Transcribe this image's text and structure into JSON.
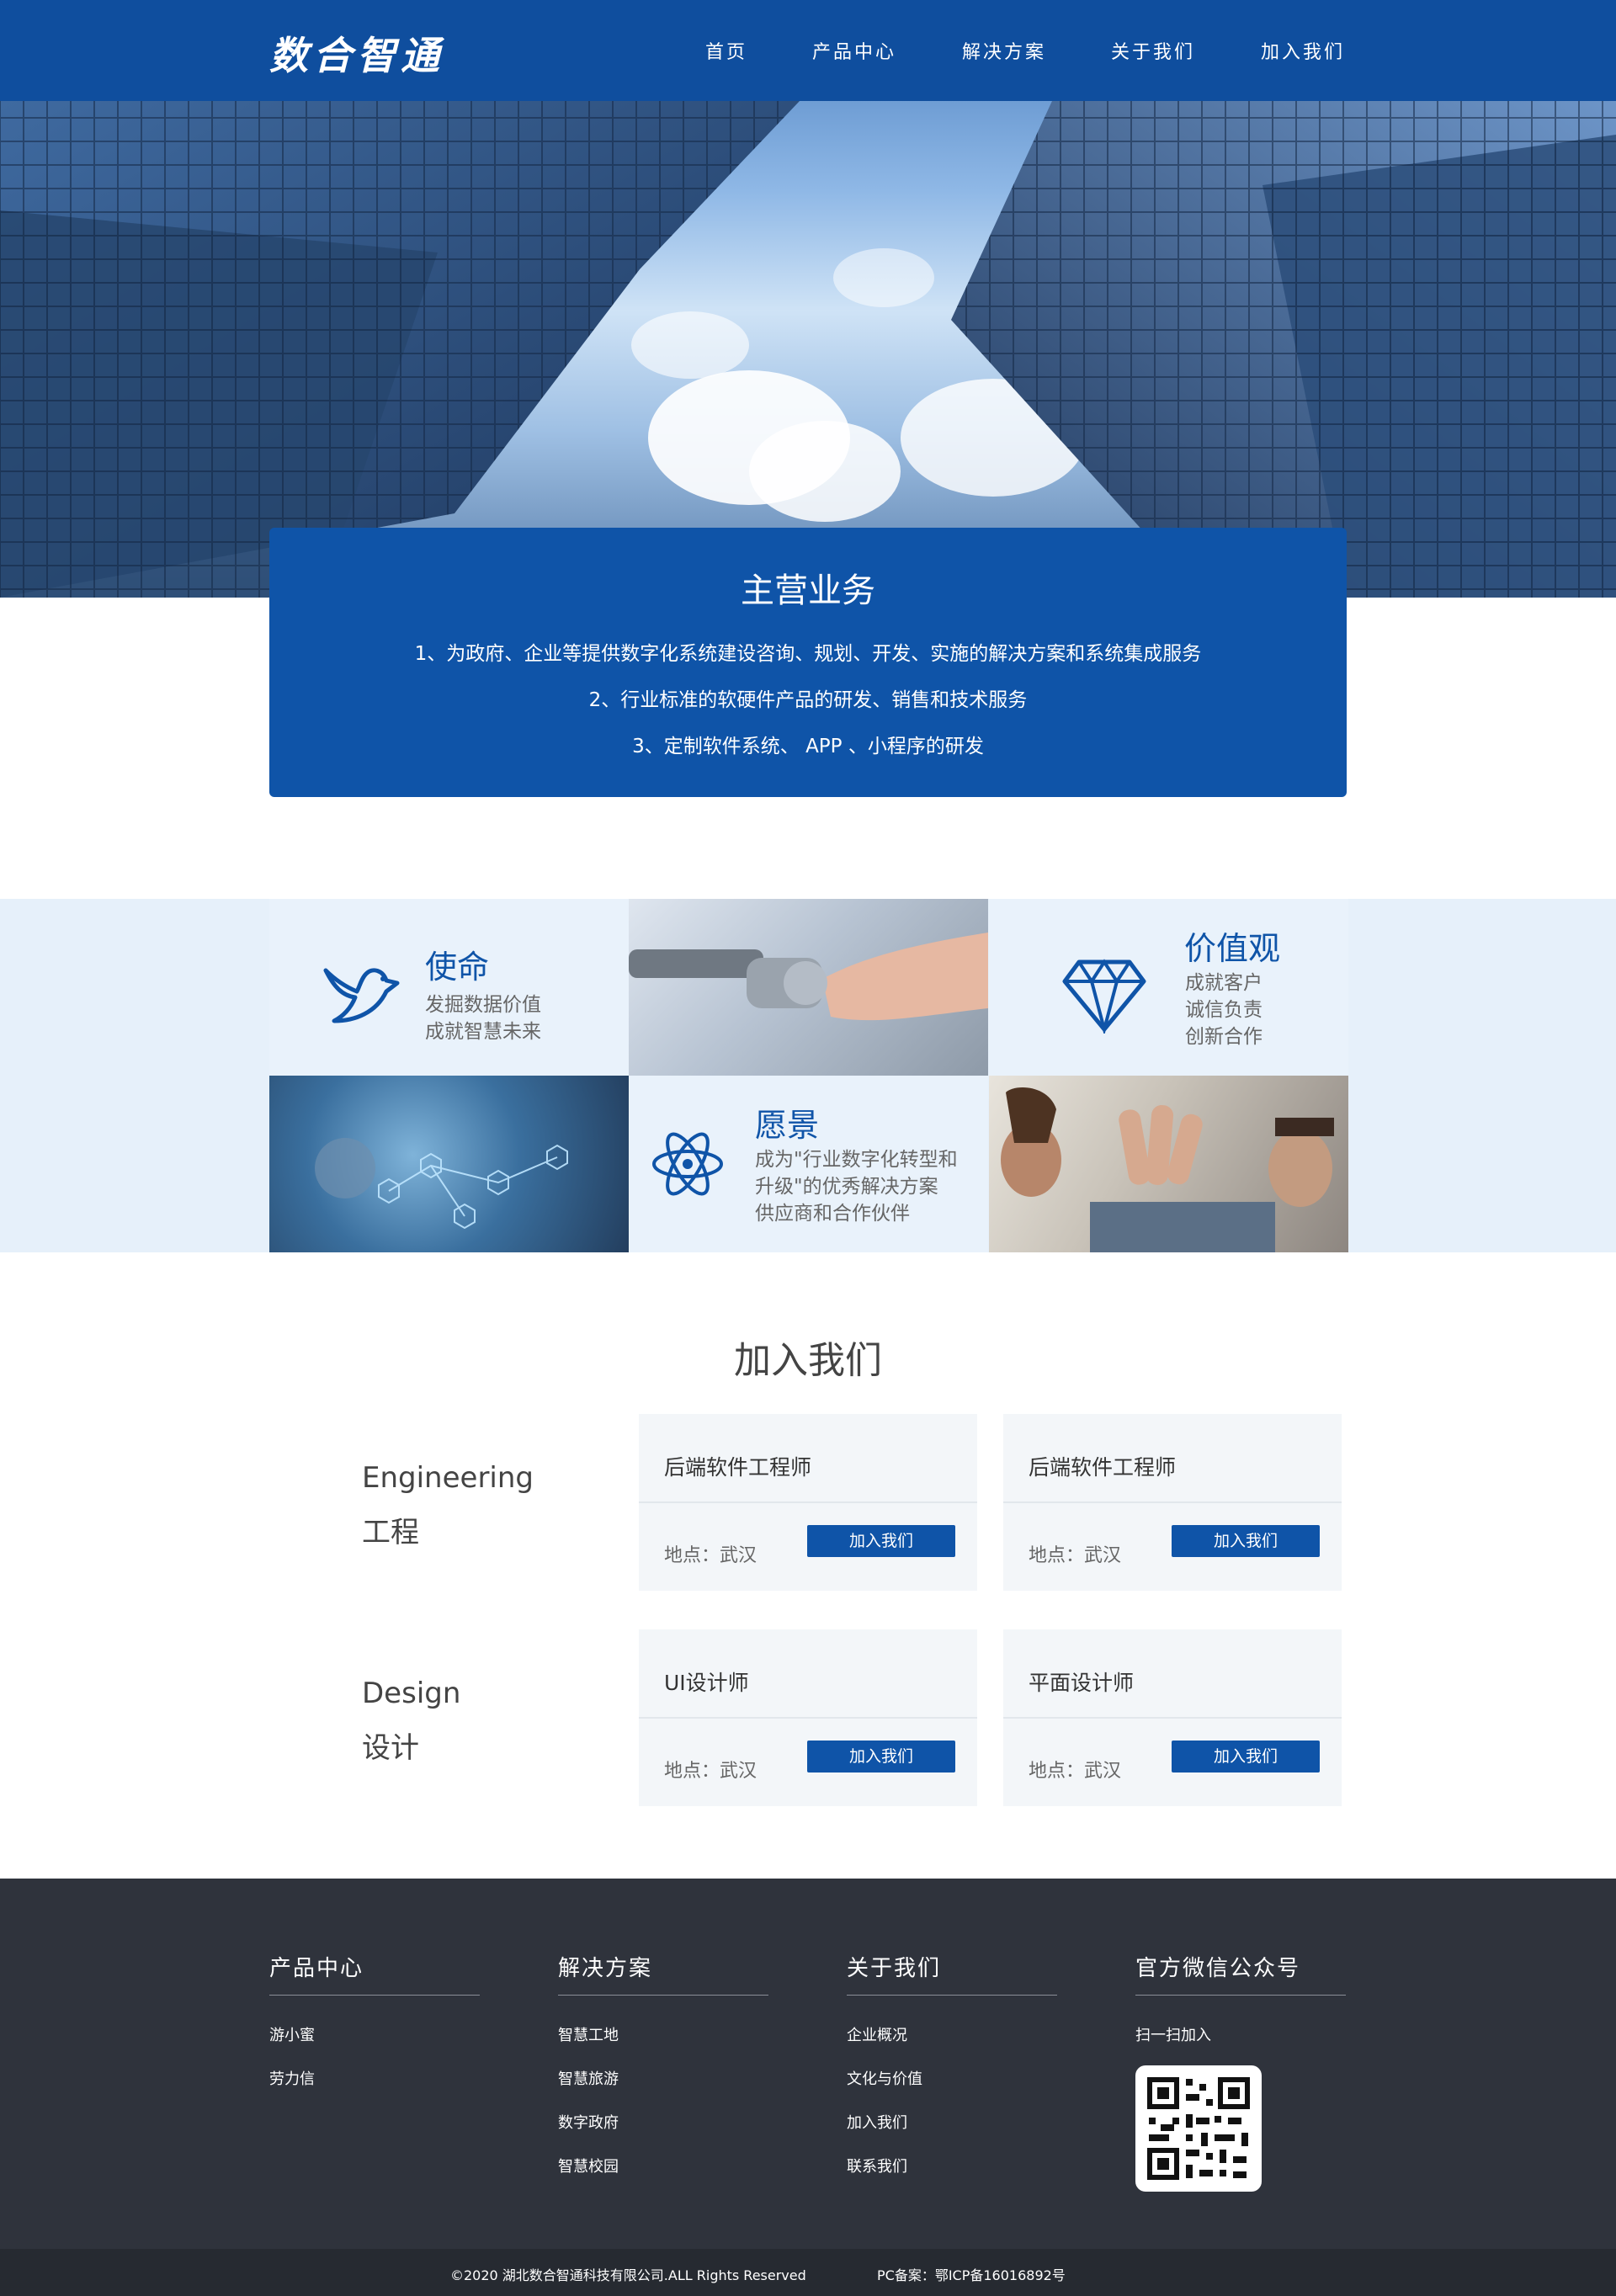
{
  "brand": {
    "logo": "数合智通"
  },
  "nav": {
    "items": [
      "首页",
      "产品中心",
      "解决方案",
      "关于我们",
      "加入我们"
    ]
  },
  "business": {
    "title": "主营业务",
    "lines": [
      "1、为政府、企业等提供数字化系统建设咨询、规划、开发、实施的解决方案和系统集成服务",
      "2、行业标准的软硬件产品的研发、销售和技术服务",
      "3、定制软件系统、 APP 、小程序的研发"
    ]
  },
  "values": {
    "mission": {
      "title": "使命",
      "lines": [
        "发掘数据价值",
        "成就智慧未来"
      ],
      "icon": "dove-icon"
    },
    "value": {
      "title": "价值观",
      "lines": [
        "成就客户",
        "诚信负责",
        "创新合作"
      ],
      "icon": "diamond-icon"
    },
    "vision": {
      "title": "愿景",
      "lines": [
        "成为\"行业数字化转型和",
        "升级\"的优秀解决方案",
        "供应商和合作伙伴"
      ],
      "icon": "atom-icon"
    }
  },
  "join": {
    "title": "加入我们",
    "categories": [
      {
        "en": "Engineering",
        "cn": "工程",
        "jobs": [
          {
            "title": "后端软件工程师",
            "location": "地点：武汉",
            "button": "加入我们"
          },
          {
            "title": "后端软件工程师",
            "location": "地点：武汉",
            "button": "加入我们"
          }
        ]
      },
      {
        "en": "Design",
        "cn": "设计",
        "jobs": [
          {
            "title": "UI设计师",
            "location": "地点：武汉",
            "button": "加入我们"
          },
          {
            "title": "平面设计师",
            "location": "地点：武汉",
            "button": "加入我们"
          }
        ]
      }
    ]
  },
  "footer": {
    "columns": [
      {
        "heading": "产品中心",
        "links": [
          "游小蜜",
          "劳力信"
        ]
      },
      {
        "heading": "解决方案",
        "links": [
          "智慧工地",
          "智慧旅游",
          "数字政府",
          "智慧校园"
        ]
      },
      {
        "heading": "关于我们",
        "links": [
          "企业概况",
          "文化与价值",
          "加入我们",
          "联系我们"
        ]
      },
      {
        "heading": "官方微信公众号",
        "links": [
          "扫一扫加入"
        ]
      }
    ],
    "copyright": "©2020 湖北数合智通科技有限公司.ALL Rights Reserved",
    "icp": "PC备案：鄂ICP备16016892号"
  },
  "colors": {
    "primary": "#0f54a8",
    "nav": "#0f4e9e",
    "footer": "#2f333c",
    "light_bg": "#e6f0fa"
  }
}
